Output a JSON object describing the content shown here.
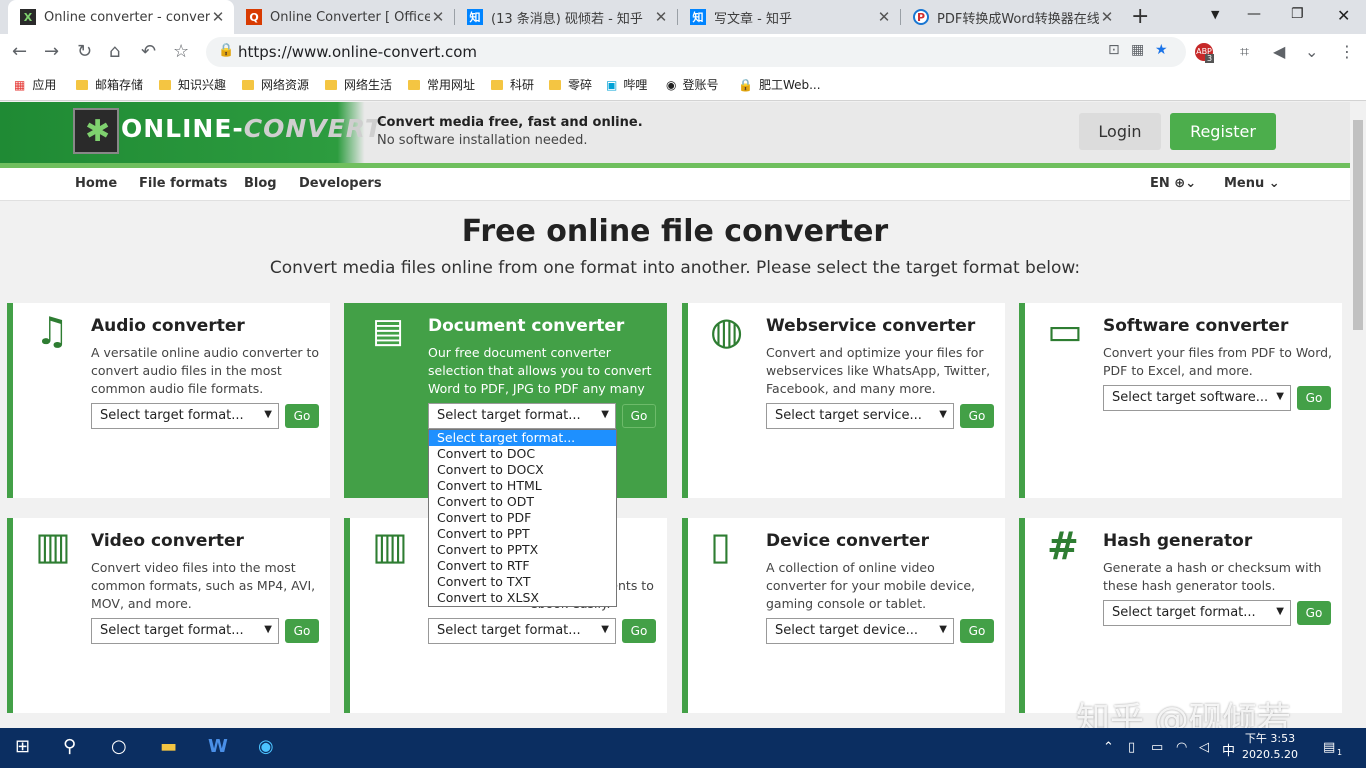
{
  "browser": {
    "tabs": [
      {
        "title": "Online converter - convert vi",
        "active": true,
        "favicon": "online-convert-favicon"
      },
      {
        "title": "Online Converter [ Office Co",
        "active": false,
        "favicon": "red-q-favicon"
      },
      {
        "title": "(13 条消息) 砚倾若 - 知乎",
        "active": false,
        "favicon": "zhihu-favicon"
      },
      {
        "title": "写文章 - 知乎",
        "active": false,
        "favicon": "zhihu-favicon"
      },
      {
        "title": "PDF转换成Word转换器在线免",
        "active": false,
        "favicon": "pdf-converter-favicon"
      }
    ],
    "url": "https://www.online-convert.com",
    "bookmarks": [
      "应用",
      "邮箱存储",
      "知识兴趣",
      "网络资源",
      "网络生活",
      "常用网址",
      "科研",
      "零碎",
      "哔哩",
      "登账号",
      "肥工Web..."
    ],
    "extension_badge": "3",
    "colors": {
      "active_tab": "#ffffff",
      "tab_strip": "#dee1e6",
      "bookmark_star": "#1a73e8"
    }
  },
  "site": {
    "logo_text_a": "ONLINE-",
    "logo_text_b": "CONVERT",
    "tagline": "Convert media free, fast and online.",
    "tagline2": "No software installation needed.",
    "login": "Login",
    "register": "Register",
    "nav": [
      "Home",
      "File formats",
      "Blog",
      "Developers"
    ],
    "lang": "EN",
    "menu": "Menu",
    "heading": "Free online file converter",
    "subheading": "Convert media files online from one format into another. Please select the target format below:",
    "go": "Go",
    "colors": {
      "brand_green": "#43a047",
      "register": "#4cae4c"
    },
    "cards": [
      {
        "title": "Audio converter",
        "icon": "music-note-icon",
        "desc": "A versatile online audio converter to convert audio files in the most common audio file formats.",
        "select": "Select target format..."
      },
      {
        "title": "Document converter",
        "icon": "document-icon",
        "desc": "Our free document converter selection that allows you to convert Word to PDF, JPG to PDF any many more.",
        "select": "Select target format..."
      },
      {
        "title": "Webservice converter",
        "icon": "globe-icon",
        "desc": "Convert and optimize your files for webservices like WhatsApp, Twitter, Facebook, and many more.",
        "select": "Select target service..."
      },
      {
        "title": "Software converter",
        "icon": "monitor-icon",
        "desc": "Convert your files from PDF to Word, PDF to Excel, and more.",
        "select": "Select target software..."
      },
      {
        "title": "Video converter",
        "icon": "film-icon",
        "desc": "Convert video files into the most common formats, such as MP4, AVI, MOV, and more.",
        "select": "Select target format..."
      },
      {
        "title": "",
        "icon": "books-icon",
        "desc": "r text documents to ebook easily.",
        "select": "Select target format..."
      },
      {
        "title": "Device converter",
        "icon": "tablet-icon",
        "desc": "A collection of online video converter for your mobile device, gaming console or tablet.",
        "select": "Select target device..."
      },
      {
        "title": "Hash generator",
        "icon": "hash-icon",
        "desc": "Generate a hash or checksum with these hash generator tools.",
        "select": "Select target format..."
      }
    ],
    "dropdown_options": [
      "Select target format...",
      "Convert to DOC",
      "Convert to DOCX",
      "Convert to HTML",
      "Convert to ODT",
      "Convert to PDF",
      "Convert to PPT",
      "Convert to PPTX",
      "Convert to RTF",
      "Convert to TXT",
      "Convert to XLSX"
    ],
    "dropdown_selected": "Select target format..."
  },
  "watermark": "知乎 @砚倾若",
  "taskbar": {
    "time": "下午 3:53",
    "date": "2020.5.20",
    "ime": "中",
    "notifications": "1"
  }
}
